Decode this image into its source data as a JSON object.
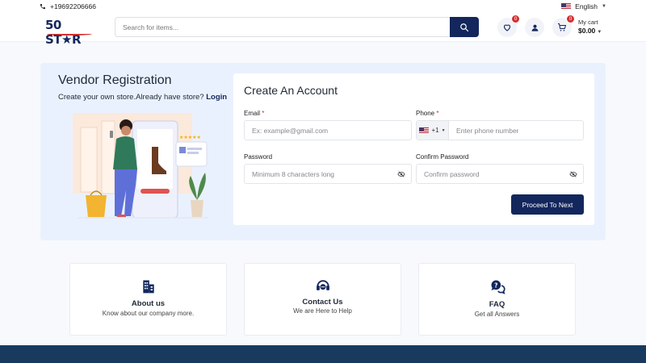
{
  "topbar": {
    "phone": "+19692206666",
    "language": "English"
  },
  "header": {
    "logo": "50 ST★R",
    "search_placeholder": "Search for items...",
    "wishlist_count": "0",
    "cart_count": "0",
    "cart_label": "My cart",
    "cart_amount": "$0.00"
  },
  "vendor": {
    "title": "Vendor Registration",
    "subtitle": "Create your own store.Already have store?",
    "login_link": "Login"
  },
  "form": {
    "title": "Create An Account",
    "email_label": "Email",
    "email_placeholder": "Ex: example@gmail.com",
    "phone_label": "Phone",
    "phone_code": "+1",
    "phone_placeholder": "Enter phone number",
    "password_label": "Password",
    "password_placeholder": "Minimum 8 characters long",
    "confirm_label": "Confirm Password",
    "confirm_placeholder": "Confirm password",
    "required_mark": "*",
    "submit_label": "Proceed To Next"
  },
  "info": [
    {
      "title": "About us",
      "subtitle": "Know about our company more."
    },
    {
      "title": "Contact Us",
      "subtitle": "We are Here to Help"
    },
    {
      "title": "FAQ",
      "subtitle": "Get all Answers"
    }
  ],
  "colors": {
    "brand_navy": "#13275d",
    "accent_red": "#d32f2f",
    "panel_bg": "#eaf1fe",
    "footer": "#173a5e"
  }
}
